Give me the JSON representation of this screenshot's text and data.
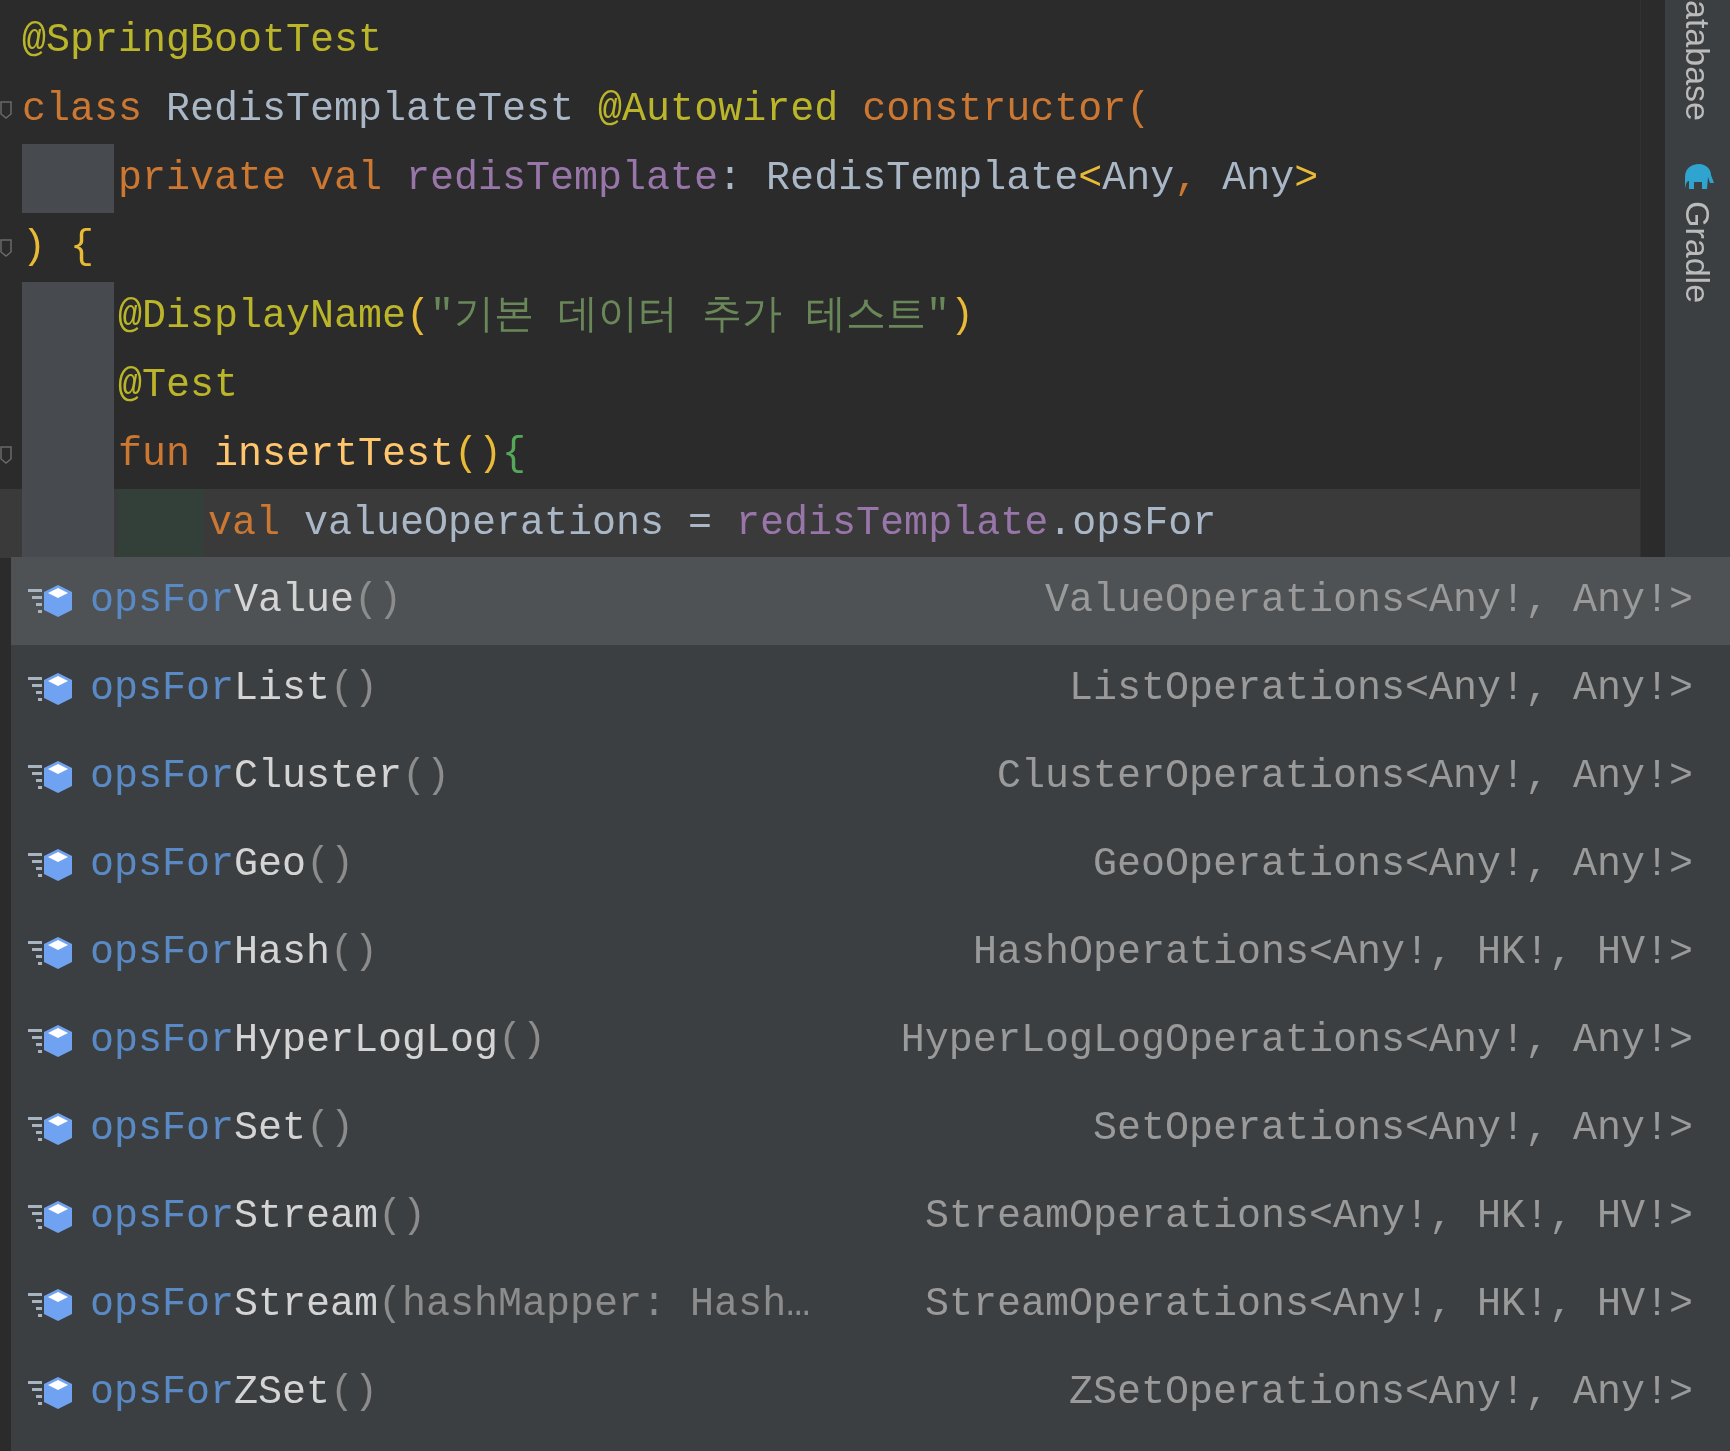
{
  "editor": {
    "lines": [
      {
        "fold_marker": false,
        "current": false,
        "guide": false,
        "inner_guide": false,
        "tokens": [
          {
            "kind": "annotation",
            "text": "@SpringBootTest"
          }
        ]
      },
      {
        "fold_marker": true,
        "current": false,
        "guide": false,
        "inner_guide": false,
        "tokens": [
          {
            "kind": "keyword",
            "text": "class "
          },
          {
            "kind": "plain",
            "text": "RedisTemplateTest "
          },
          {
            "kind": "annotation",
            "text": "@Autowired "
          },
          {
            "kind": "keyword",
            "text": "constructor("
          }
        ]
      },
      {
        "fold_marker": false,
        "current": false,
        "guide": true,
        "inner_guide": false,
        "tokens": [
          {
            "kind": "keyword",
            "text": "private val "
          },
          {
            "kind": "property",
            "text": "redisTemplate"
          },
          {
            "kind": "plain",
            "text": ": RedisTemplate"
          },
          {
            "kind": "bracket",
            "text": "<"
          },
          {
            "kind": "plain",
            "text": "Any"
          },
          {
            "kind": "keyword",
            "text": ", "
          },
          {
            "kind": "plain",
            "text": "Any"
          },
          {
            "kind": "bracket",
            "text": ">"
          }
        ]
      },
      {
        "fold_marker": true,
        "current": false,
        "guide": false,
        "inner_guide": false,
        "tokens": [
          {
            "kind": "bracket",
            "text": ") {"
          }
        ]
      },
      {
        "fold_marker": false,
        "current": false,
        "guide": true,
        "inner_guide": false,
        "tokens": [
          {
            "kind": "annotation",
            "text": "@DisplayName"
          },
          {
            "kind": "bracket",
            "text": "("
          },
          {
            "kind": "string",
            "text": "\"기본 데이터 추가 테스트\""
          },
          {
            "kind": "bracket",
            "text": ")"
          }
        ]
      },
      {
        "fold_marker": false,
        "current": false,
        "guide": true,
        "inner_guide": false,
        "tokens": [
          {
            "kind": "annotation",
            "text": "@Test"
          }
        ]
      },
      {
        "fold_marker": true,
        "current": false,
        "guide": true,
        "inner_guide": false,
        "tokens": [
          {
            "kind": "keyword",
            "text": "fun "
          },
          {
            "kind": "function",
            "text": "insertTest"
          },
          {
            "kind": "bracket",
            "text": "()"
          },
          {
            "kind": "bracket_inner",
            "text": "{"
          }
        ]
      },
      {
        "fold_marker": false,
        "current": true,
        "guide": true,
        "inner_guide": true,
        "tokens": [
          {
            "kind": "keyword",
            "text": "val "
          },
          {
            "kind": "plain",
            "text": "valueOperations = "
          },
          {
            "kind": "property",
            "text": "redisTemplate"
          },
          {
            "kind": "plain",
            "text": ".opsFor"
          }
        ]
      }
    ]
  },
  "sidebar": {
    "tabs": [
      {
        "label": "atabase",
        "kind": "text"
      },
      {
        "label": "Gradle",
        "kind": "with_icon"
      }
    ]
  },
  "completion": {
    "items": [
      {
        "prefix": "opsFor",
        "name": "Value",
        "params": "()",
        "type": "ValueOperations<Any!, Any!>",
        "selected": true
      },
      {
        "prefix": "opsFor",
        "name": "List",
        "params": "()",
        "type": "ListOperations<Any!, Any!>",
        "selected": false
      },
      {
        "prefix": "opsFor",
        "name": "Cluster",
        "params": "()",
        "type": "ClusterOperations<Any!, Any!>",
        "selected": false
      },
      {
        "prefix": "opsFor",
        "name": "Geo",
        "params": "()",
        "type": "GeoOperations<Any!, Any!>",
        "selected": false
      },
      {
        "prefix": "opsFor",
        "name": "Hash",
        "params": "()",
        "type": "HashOperations<Any!, HK!, HV!>",
        "selected": false
      },
      {
        "prefix": "opsFor",
        "name": "HyperLogLog",
        "params": "()",
        "type": "HyperLogLogOperations<Any!, Any!>",
        "selected": false
      },
      {
        "prefix": "opsFor",
        "name": "Set",
        "params": "()",
        "type": "SetOperations<Any!, Any!>",
        "selected": false
      },
      {
        "prefix": "opsFor",
        "name": "Stream",
        "params": "()",
        "type": "StreamOperations<Any!, HK!, HV!>",
        "selected": false
      },
      {
        "prefix": "opsFor",
        "name": "Stream",
        "params": "(hashMapper: Hash…",
        "type": "StreamOperations<Any!, HK!, HV!>",
        "selected": false
      },
      {
        "prefix": "opsFor",
        "name": "ZSet",
        "params": "()",
        "type": "ZSetOperations<Any!, Any!>",
        "selected": false
      }
    ]
  }
}
